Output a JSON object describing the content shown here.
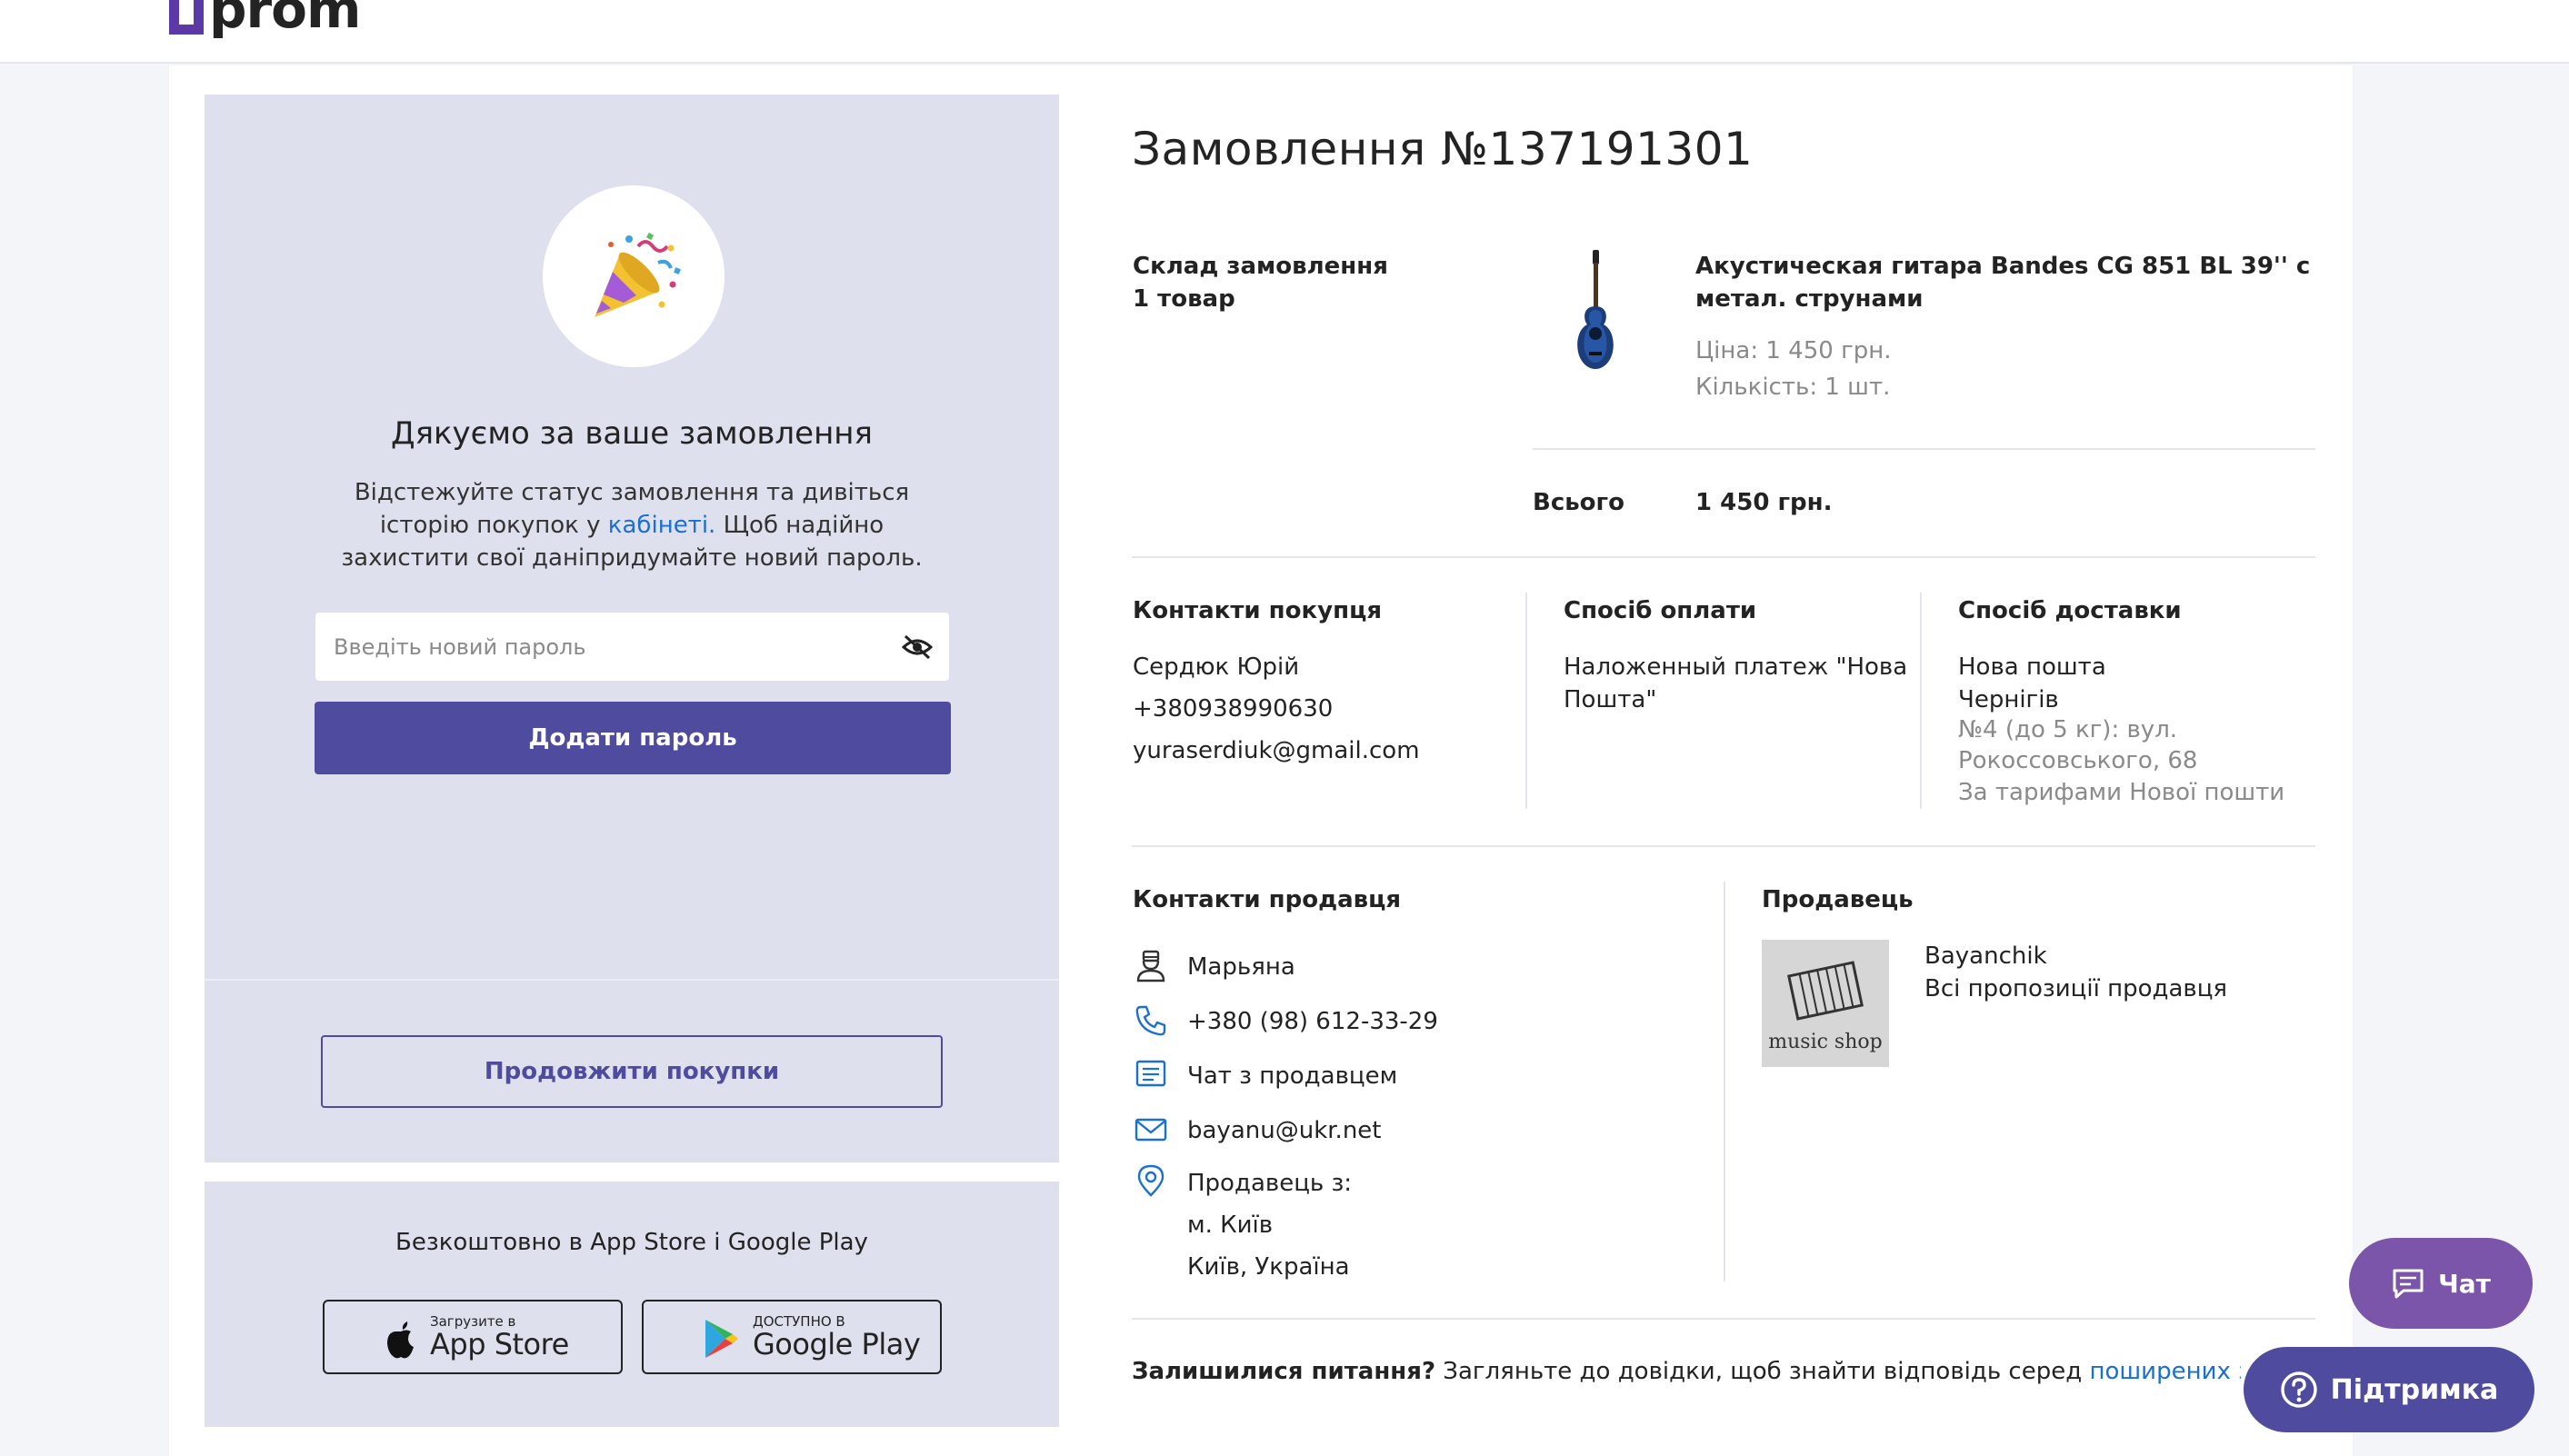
{
  "header": {
    "logo_text": "prom"
  },
  "left": {
    "thanks_title": "Дякуємо за ваше замовлення",
    "thanks_text_1": "Відстежуйте статус замовлення та дивіться історію покупок у ",
    "thanks_link": "кабінеті.",
    "thanks_text_2": " Щоб надійно захистити свої даніпридумайте новий пароль.",
    "password_placeholder": "Введіть новий пароль",
    "add_password_label": "Додати пароль",
    "continue_label": "Продовжити покупки",
    "apps_text": "Безкоштовно в App Store і Google Play",
    "appstore_small": "Загрузите в",
    "appstore_big": "App Store",
    "googleplay_small": "ДОСТУПНО В",
    "googleplay_big": "Google Play"
  },
  "order": {
    "title": "Замовлення №137191301",
    "composition_label": "Склад замовлення",
    "items_count": "1 товар",
    "product_name": "Акустическая гитара Bandes CG 851 BL 39'' с метал. струнами",
    "price": "Ціна: 1 450 грн.",
    "quantity": "Кількість: 1 шт.",
    "total_label": "Всього",
    "total_value": "1 450 грн."
  },
  "buyer": {
    "label": "Контакти покупця",
    "name": "Сердюк Юрій",
    "phone": "+380938990630",
    "email": "yuraserdiuk@gmail.com"
  },
  "payment": {
    "label": "Спосіб оплати",
    "value": "Наложенный платеж \"Нова Пошта\""
  },
  "delivery": {
    "label": "Спосіб доставки",
    "service": "Нова пошта",
    "city": "Чернігів",
    "branch": "№4 (до 5 кг): вул. Рокоссовського, 68",
    "tariff": "За тарифами Нової пошти"
  },
  "seller_contacts": {
    "label": "Контакти продавця",
    "name": "Марьяна",
    "phone": "+380 (98) 612-33-29",
    "chat": "Чат з продавцем",
    "email": "bayanu@ukr.net",
    "from_label": "Продавець з:",
    "city": "м. Київ",
    "country": "Київ, Україна"
  },
  "seller": {
    "label": "Продавець",
    "name": "Bayanchik",
    "all_offers": "Всі пропозиції продавця",
    "thumb_text": "music shop"
  },
  "faq": {
    "bold": "Залишилися питання?",
    "text": " Загляньте до довідки, щоб знайти відповідь серед ",
    "link": "поширених запитань"
  },
  "floating": {
    "chat_label": "Чат",
    "support_label": "Підтримка"
  },
  "colors": {
    "accent": "#4f4b9e",
    "link": "#1b6fd1",
    "panel": "#dfe0ee",
    "chat": "#7b55a9"
  }
}
